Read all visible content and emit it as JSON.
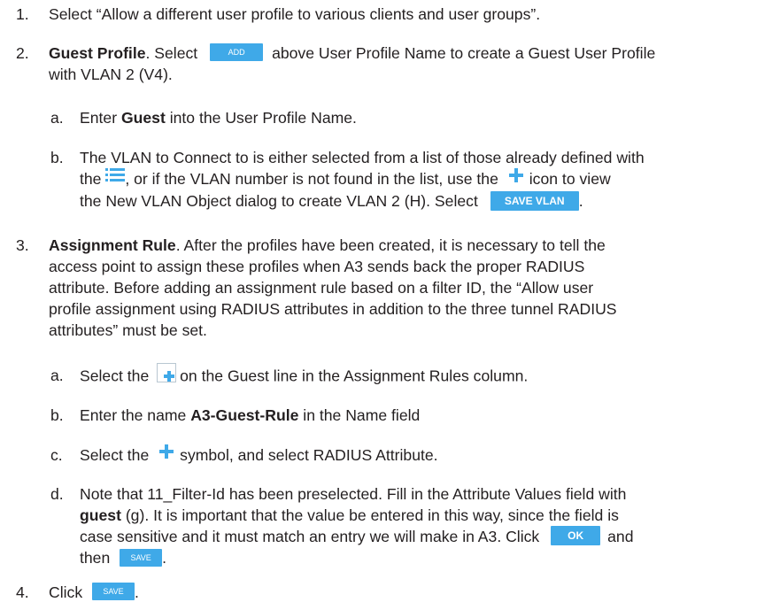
{
  "steps": [
    {
      "num": "1.",
      "text": "Select “Allow a different user profile to various clients and user groups”."
    },
    {
      "num": "2.",
      "bold": "Guest Profile",
      "before_button": ". Select",
      "button": "ADD",
      "after_button": "above User Profile Name to create a Guest User Profile",
      "line2": "with VLAN 2 (V4).",
      "sub": [
        {
          "num": "a.",
          "pre": "Enter ",
          "bold": "Guest",
          "post": " into the User Profile Name."
        },
        {
          "num": "b.",
          "line1": "The VLAN to Connect to is either selected from a list of those already defined with",
          "line2_pre": "the",
          "line2_mid": ", or if the VLAN number is not found in the list, use the",
          "line2_post": "icon to view",
          "line3": "the New VLAN Object dialog to create VLAN 2 (H). Select",
          "button": "SAVE VLAN",
          "end": "."
        }
      ]
    },
    {
      "num": "3.",
      "bold": "Assignment Rule",
      "line1": ". After the profiles have been created, it is necessary to tell the",
      "line2": "access point to assign these profiles when A3 sends back the proper RADIUS",
      "line3": "attribute. Before adding an assignment rule based on a filter ID, the “Allow user",
      "line4": "profile assignment using RADIUS attributes in addition to the three tunnel RADIUS",
      "line5": "attributes” must be set.",
      "sub": [
        {
          "num": "a.",
          "pre": "Select the",
          "post": "on the Guest line in the Assignment Rules column."
        },
        {
          "num": "b.",
          "pre": "Enter the name ",
          "bold": "A3-Guest-Rule",
          "post": " in the Name field"
        },
        {
          "num": "c.",
          "pre": "Select the",
          "post": "symbol, and select RADIUS Attribute."
        },
        {
          "num": "d.",
          "line1": "Note that 11_Filter-Id has been preselected. Fill in the Attribute Values field with",
          "line2_bold": "guest",
          "line2": " (g). It is important that the value be entered in this way, since the field is",
          "line3": "case sensitive and it must match an entry we will make in A3. Click",
          "button_ok": "OK",
          "line3_post": "and",
          "line4": "then",
          "button_save": "SAVE",
          "end": "."
        }
      ]
    },
    {
      "num": "4.",
      "pre": "Click",
      "button": "SAVE",
      "end": "."
    }
  ],
  "icons": {
    "list": "list-icon",
    "plus": "plus-icon",
    "assign": "add-assignment-icon"
  },
  "colors": {
    "button": "#3fa9e8",
    "plus": "#3fa9e8",
    "text": "#231f20"
  }
}
